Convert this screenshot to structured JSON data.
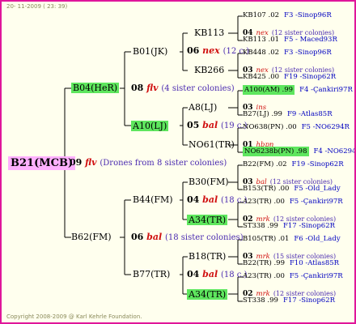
{
  "header": {
    "date": "20- 11-2009 ( 23: 39)"
  },
  "footer": {
    "copyright": "Copyright 2008-2009 @ Karl Kehrle Foundation."
  },
  "root": {
    "label": "B21(MCB)",
    "year": "09",
    "code": "flv",
    "note": "(Drones from 8 sister colonies)"
  },
  "gen1": [
    {
      "label": "B04(HeR)",
      "year": "08",
      "code": "flv",
      "note": "(4 sister colonies)"
    },
    {
      "label": "B62(FM)",
      "year": "06",
      "code": "bal",
      "note": "(18 sister colonies)"
    }
  ],
  "gen2": [
    {
      "label": "B01(JK)",
      "year": "06",
      "code": "nex",
      "note": "(12 c.)"
    },
    {
      "label": "A10(LJ)",
      "year": "05",
      "code": "bal",
      "note": "(19 c.)"
    },
    {
      "label": "B44(FM)",
      "year": "04",
      "code": "bal",
      "note": "(18 c.)"
    },
    {
      "label": "B77(TR)",
      "year": "04",
      "code": "bal",
      "note": "(18 c.)"
    }
  ],
  "gen3": [
    {
      "label": "KB113"
    },
    {
      "label": "KB266"
    },
    {
      "label": "A8(LJ)"
    },
    {
      "label": "NO61(TR)"
    },
    {
      "label": "B30(FM)"
    },
    {
      "label": "A34(TR)"
    },
    {
      "label": "B18(TR)"
    },
    {
      "label": "A34(TR)"
    }
  ],
  "gen4": [
    {
      "top": "KB107 .02",
      "top_ref": "F3 -Sinop96R",
      "mid_year": "04",
      "mid_code": "nex",
      "mid_note": "(12 sister colonies)",
      "bot": "KB113 .01",
      "bot_ref": "F5 - Maced93R"
    },
    {
      "top": "KB448 .02",
      "top_ref": "F3 -Sinop96R",
      "mid_year": "03",
      "mid_code": "nex",
      "mid_note": "(12 sister colonies)",
      "bot": "KB425 .00",
      "bot_ref": "F19 -Sinop62R"
    },
    {
      "top": "A100(AM) .99",
      "top_ref": "F4 -Çankiri97R",
      "mid_year": "03",
      "mid_code": "ins",
      "mid_note": "",
      "bot": "B27(LJ) .99",
      "bot_ref": "F9 -Atlas85R"
    },
    {
      "top": "NO638(PN) .00",
      "top_ref": "F5 -NO6294R",
      "mid_year": "01",
      "mid_code": "hbpn",
      "mid_note": "",
      "bot": "NO6238b(PN) .98",
      "bot_ref": "F4 -NO6294R"
    },
    {
      "top": "B22(FM) .02",
      "top_ref": "F19 -Sinop62R",
      "mid_year": "03",
      "mid_code": "bal",
      "mid_note": "(12 sister colonies)",
      "bot": "B153(TR) .00",
      "bot_ref": "F5 -Old_Lady"
    },
    {
      "top": "A23(TR) .00",
      "top_ref": "F5 -Çankiri97R",
      "mid_year": "02",
      "mid_code": "mrk",
      "mid_note": "(12 sister colonies)",
      "bot": "ST338 .99",
      "bot_ref": "F17 -Sinop62R"
    },
    {
      "top": "B105(TR) .01",
      "top_ref": "F6 -Old_Lady",
      "mid_year": "03",
      "mid_code": "mrk",
      "mid_note": "(15 sister colonies)",
      "bot": "B22(TR) .99",
      "bot_ref": "F10 -Atlas85R"
    },
    {
      "top": "A23(TR) .00",
      "top_ref": "F5 -Çankiri97R",
      "mid_year": "02",
      "mid_code": "mrk",
      "mid_note": "(12 sister colonies)",
      "bot": "ST338 .99",
      "bot_ref": "F17 -Sinop62R"
    }
  ]
}
